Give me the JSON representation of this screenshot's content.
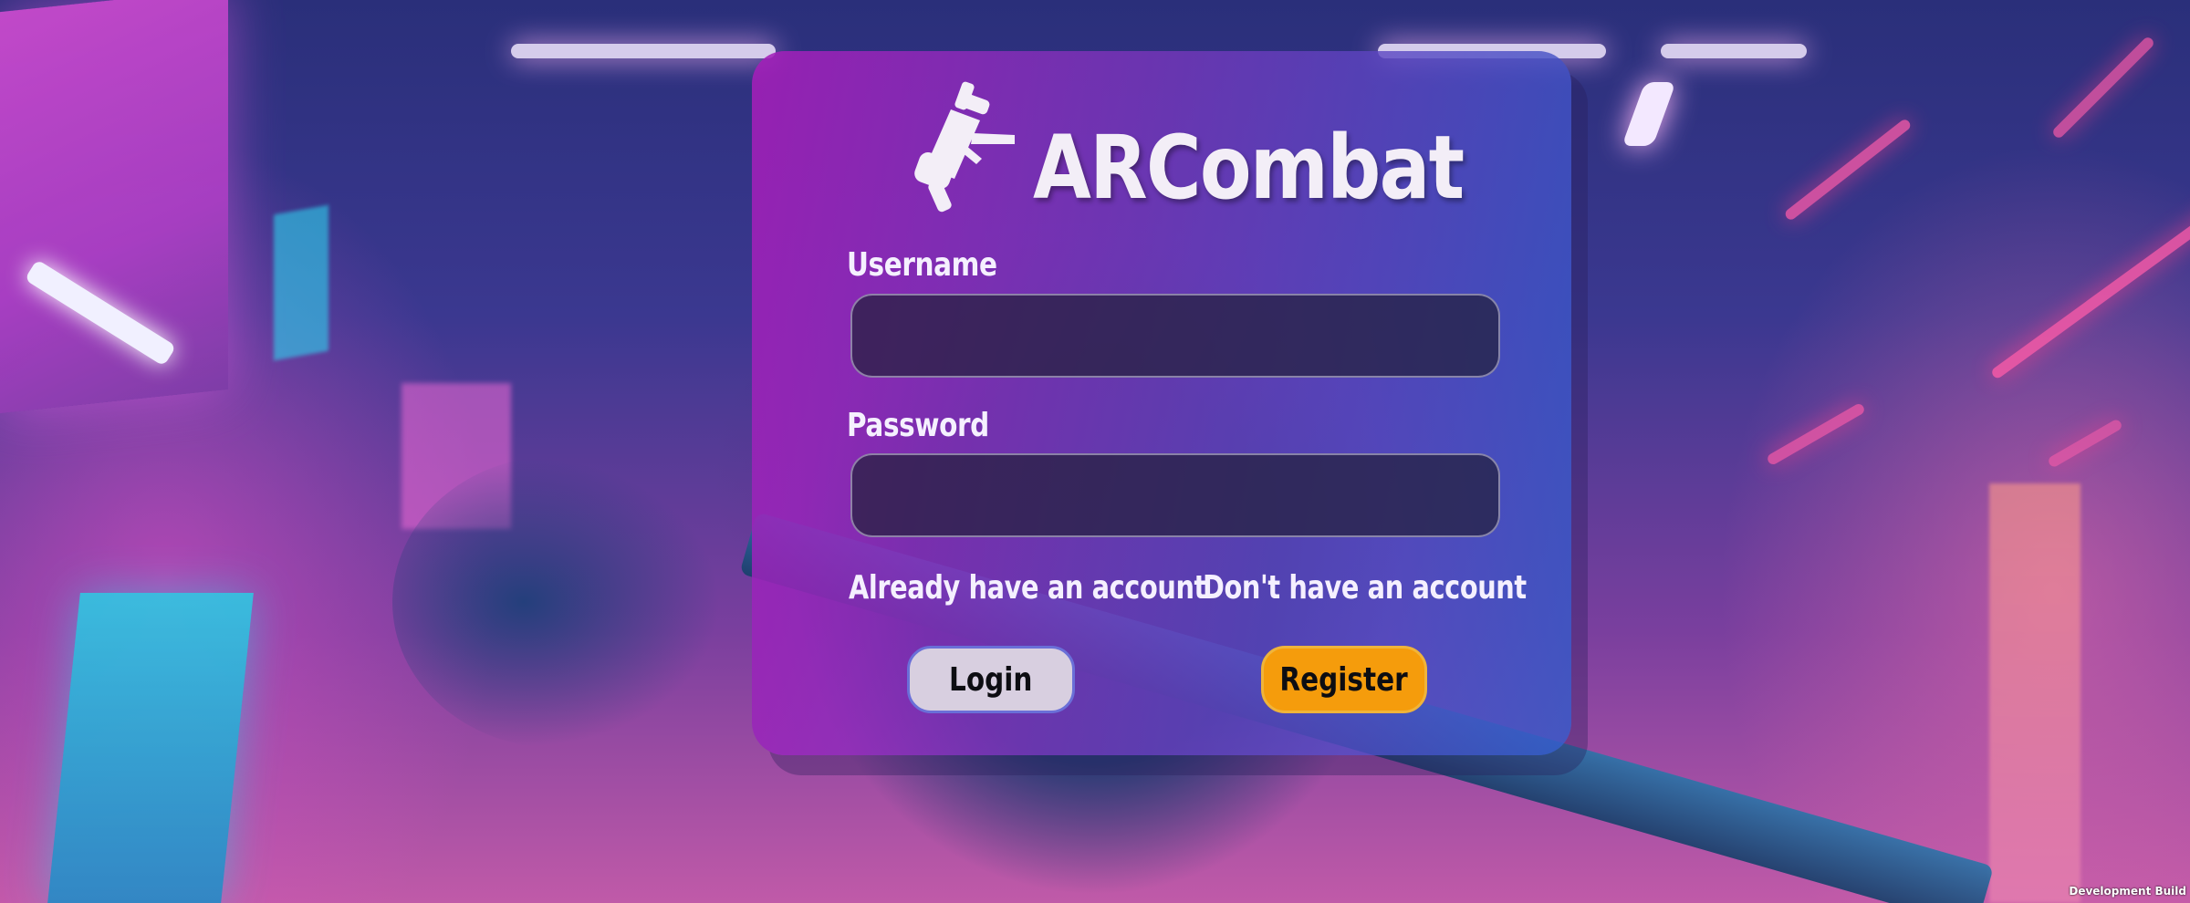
{
  "app": {
    "title": "ARCombat",
    "logo_icon": "gun-icon"
  },
  "form": {
    "username_label": "Username",
    "username_value": "",
    "password_label": "Password",
    "password_value": ""
  },
  "actions": {
    "login_hint": "Already have an account",
    "register_hint": "Don't have an account",
    "login_label": "Login",
    "register_label": "Register"
  },
  "footer": {
    "build_label": "Development Build"
  },
  "colors": {
    "register_button": "#f59c0c",
    "login_button": "#d8cfe0",
    "card_gradient_start": "#a51eb9",
    "card_gradient_end": "#325ac8"
  }
}
